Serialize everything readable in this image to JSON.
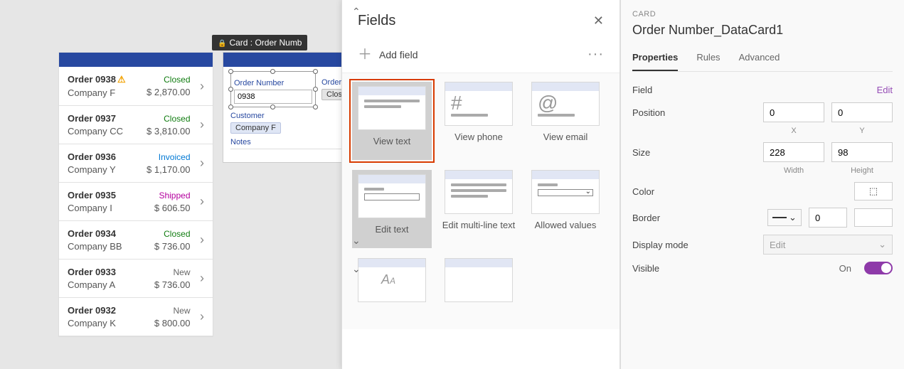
{
  "tooltip": {
    "text": "Card : Order Numb"
  },
  "orders": [
    {
      "title": "Order 0938",
      "company": "Company F",
      "status": "Closed",
      "statusClass": "status-closed",
      "amount": "$ 2,870.00",
      "warn": true
    },
    {
      "title": "Order 0937",
      "company": "Company CC",
      "status": "Closed",
      "statusClass": "status-closed",
      "amount": "$ 3,810.00"
    },
    {
      "title": "Order 0936",
      "company": "Company Y",
      "status": "Invoiced",
      "statusClass": "status-invoiced",
      "amount": "$ 1,170.00"
    },
    {
      "title": "Order 0935",
      "company": "Company I",
      "status": "Shipped",
      "statusClass": "status-shipped",
      "amount": "$ 606.50"
    },
    {
      "title": "Order 0934",
      "company": "Company BB",
      "status": "Closed",
      "statusClass": "status-closed",
      "amount": "$ 736.00"
    },
    {
      "title": "Order 0933",
      "company": "Company A",
      "status": "New",
      "statusClass": "status-new",
      "amount": "$ 736.00"
    },
    {
      "title": "Order 0932",
      "company": "Company K",
      "status": "New",
      "statusClass": "status-new",
      "amount": "$ 800.00"
    }
  ],
  "form": {
    "orderNumberLabel": "Order Number",
    "orderNumberValue": "0938",
    "orderStatusLabel": "Order S",
    "orderStatusValue": "Closed",
    "customerLabel": "Customer",
    "customerValue": "Company F",
    "notesLabel": "Notes"
  },
  "fieldsPanel": {
    "title": "Fields",
    "addField": "Add field",
    "types": [
      {
        "id": "view-text",
        "label": "View text"
      },
      {
        "id": "view-phone",
        "label": "View phone",
        "glyph": "#"
      },
      {
        "id": "view-email",
        "label": "View email",
        "glyph": "@"
      },
      {
        "id": "edit-text",
        "label": "Edit text"
      },
      {
        "id": "edit-multiline",
        "label": "Edit multi-line text"
      },
      {
        "id": "allowed-values",
        "label": "Allowed values"
      }
    ]
  },
  "propsPanel": {
    "crumb": "CARD",
    "objectName": "Order Number_DataCard1",
    "tabs": {
      "properties": "Properties",
      "rules": "Rules",
      "advanced": "Advanced"
    },
    "fieldLabel": "Field",
    "editLink": "Edit",
    "positionLabel": "Position",
    "positionX": "0",
    "positionY": "0",
    "positionXSub": "X",
    "positionYSub": "Y",
    "sizeLabel": "Size",
    "sizeW": "228",
    "sizeH": "98",
    "sizeWSub": "Width",
    "sizeHSub": "Height",
    "colorLabel": "Color",
    "borderLabel": "Border",
    "borderValue": "0",
    "displayModeLabel": "Display mode",
    "displayModeValue": "Edit",
    "visibleLabel": "Visible",
    "visibleValue": "On"
  }
}
